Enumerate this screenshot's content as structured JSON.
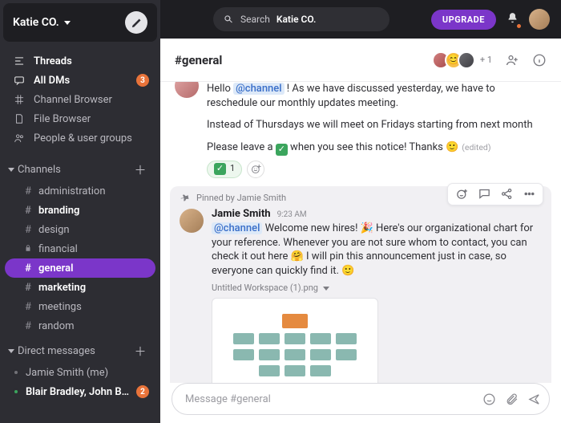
{
  "workspace": {
    "name": "Katie CO."
  },
  "search": {
    "label": "Search",
    "term": "Katie CO."
  },
  "topbar": {
    "upgrade": "UPGRADE"
  },
  "nav": {
    "threads": "Threads",
    "alldms": "All DMs",
    "alldms_badge": "3",
    "channel_browser": "Channel Browser",
    "file_browser": "File Browser",
    "people": "People & user groups"
  },
  "sections": {
    "channels_label": "Channels",
    "dms_label": "Direct messages"
  },
  "channels": [
    {
      "name": "administration",
      "prefix": "#",
      "white": false,
      "selected": false
    },
    {
      "name": "branding",
      "prefix": "#",
      "white": true,
      "selected": false
    },
    {
      "name": "design",
      "prefix": "#",
      "white": false,
      "selected": false
    },
    {
      "name": "financial",
      "prefix": "lock",
      "white": false,
      "selected": false
    },
    {
      "name": "general",
      "prefix": "#",
      "white": true,
      "selected": true
    },
    {
      "name": "marketing",
      "prefix": "#",
      "white": true,
      "selected": false
    },
    {
      "name": "meetings",
      "prefix": "#",
      "white": false,
      "selected": false
    },
    {
      "name": "random",
      "prefix": "#",
      "white": false,
      "selected": false
    }
  ],
  "dms": [
    {
      "name": "Jamie Smith (me)",
      "white": false,
      "presence": "away",
      "badge": null
    },
    {
      "name": "Blair Bradley, John Ba...",
      "white": true,
      "presence": "online",
      "badge": "2"
    }
  ],
  "header": {
    "channel_title": "#general",
    "plus_members": "+ 1"
  },
  "msg1": {
    "line1_pre": "Hello ",
    "mention": "@channel",
    "line1_post": " ! As we have discussed yesterday, we have to reschedule our monthly updates meeting.",
    "line2": "Instead of Thursdays we will meet on Fridays starting from next month",
    "line3_pre": "Please leave a ",
    "line3_post": " when you see this notice! Thanks 🙂",
    "edited": "(edited)",
    "reaction_count": "1"
  },
  "msg2": {
    "pinned_by": "Pinned by Jamie Smith",
    "author": "Jamie Smith",
    "time": "9:23 AM",
    "mention": "@channel",
    "body_post": "  Welcome new hires! 🎉 Here's our organizational chart for your reference. Whenever you are not sure whom to contact, you can check it out here 🤗  I will pin this announcement just in case, so everyone can quickly find it. 🙂",
    "attachment_name": "Untitled Workspace (1).png"
  },
  "composer": {
    "placeholder": "Message #general"
  }
}
